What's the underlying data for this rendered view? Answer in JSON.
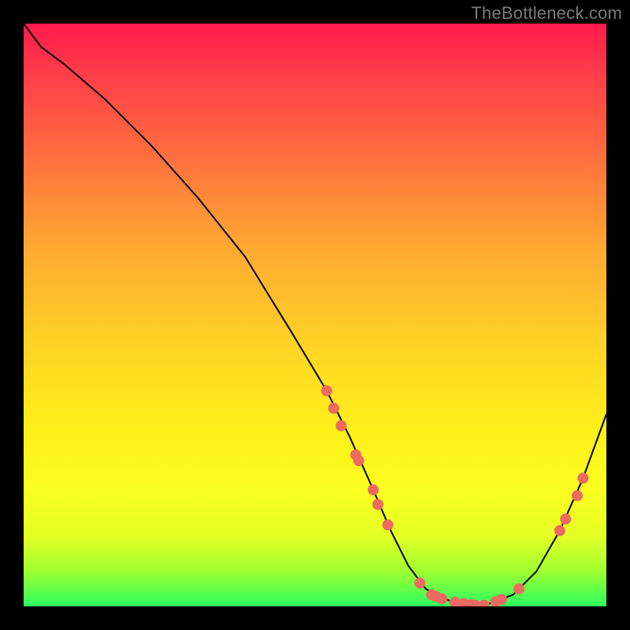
{
  "watermark": "TheBottleneck.com",
  "chart_data": {
    "type": "line",
    "title": "",
    "xlabel": "",
    "ylabel": "",
    "xlim": [
      0,
      100
    ],
    "ylim": [
      0,
      100
    ],
    "grid": false,
    "legend": false,
    "series": [
      {
        "name": "curve",
        "x": [
          0,
          3,
          7,
          14,
          22,
          30,
          38,
          46,
          52,
          56,
          60,
          63,
          66,
          69,
          73,
          77,
          80,
          84,
          88,
          92,
          96,
          100
        ],
        "y": [
          100,
          96,
          93,
          87,
          79,
          70,
          60,
          47,
          37,
          29,
          20,
          13,
          7,
          3,
          1,
          0,
          0.5,
          2,
          6,
          13,
          22,
          33
        ]
      }
    ],
    "markers": [
      {
        "x": 52,
        "y": 37
      },
      {
        "x": 53.2,
        "y": 34
      },
      {
        "x": 54.5,
        "y": 31
      },
      {
        "x": 57,
        "y": 26
      },
      {
        "x": 57.5,
        "y": 25
      },
      {
        "x": 60,
        "y": 20
      },
      {
        "x": 60.8,
        "y": 17.5
      },
      {
        "x": 62.5,
        "y": 14
      },
      {
        "x": 68,
        "y": 4
      },
      {
        "x": 70,
        "y": 2
      },
      {
        "x": 70.8,
        "y": 1.7
      },
      {
        "x": 71.8,
        "y": 1.3
      },
      {
        "x": 74,
        "y": 0.7
      },
      {
        "x": 75.5,
        "y": 0.5
      },
      {
        "x": 76.8,
        "y": 0.3
      },
      {
        "x": 77.5,
        "y": 0.2
      },
      {
        "x": 79,
        "y": 0.2
      },
      {
        "x": 81,
        "y": 0.8
      },
      {
        "x": 82,
        "y": 1.2
      },
      {
        "x": 85,
        "y": 3
      },
      {
        "x": 92,
        "y": 13
      },
      {
        "x": 93,
        "y": 15
      },
      {
        "x": 95,
        "y": 19
      },
      {
        "x": 96,
        "y": 22
      }
    ],
    "marker_color": "#ec6a5e",
    "curve_color": "#000000",
    "background_gradient": [
      "#ff1a4b",
      "#fff01a",
      "#2bff60"
    ]
  }
}
